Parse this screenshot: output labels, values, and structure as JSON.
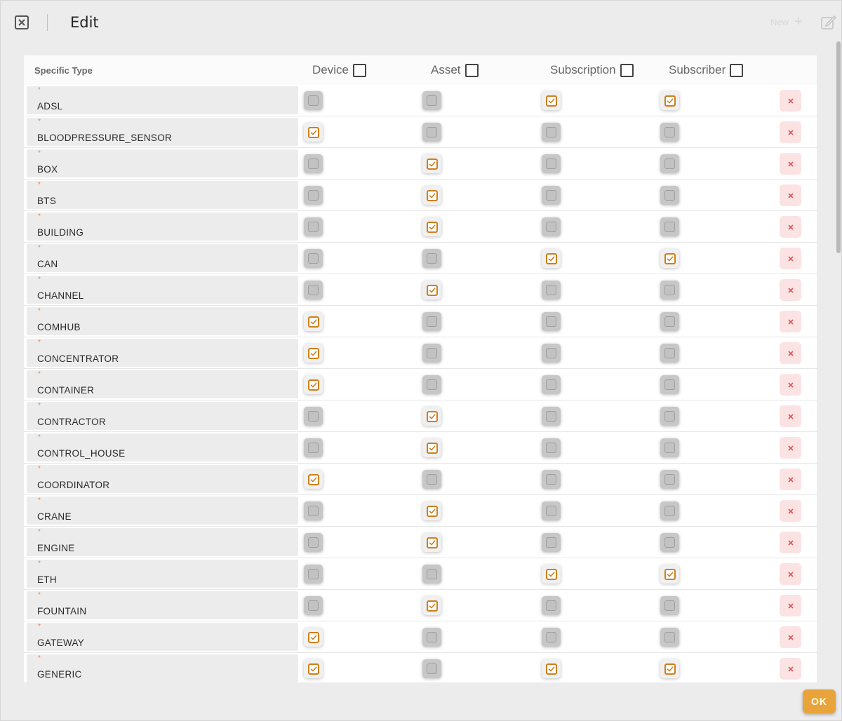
{
  "header": {
    "title": "Edit",
    "new_label": "New",
    "new_icon": "plus-icon",
    "close_icon": "close-x-icon",
    "edit_icon": "pencil-square-icon"
  },
  "table": {
    "first_column_label": "Specific Type",
    "columns": [
      "Device",
      "Asset",
      "Subscription",
      "Subscriber"
    ],
    "required_marker": "*",
    "rows": [
      {
        "type": "ADSL",
        "checks": [
          false,
          false,
          true,
          true
        ]
      },
      {
        "type": "BLOODPRESSURE_SENSOR",
        "checks": [
          true,
          false,
          false,
          false
        ]
      },
      {
        "type": "BOX",
        "checks": [
          false,
          true,
          false,
          false
        ]
      },
      {
        "type": "BTS",
        "checks": [
          false,
          true,
          false,
          false
        ]
      },
      {
        "type": "BUILDING",
        "checks": [
          false,
          true,
          false,
          false
        ]
      },
      {
        "type": "CAN",
        "checks": [
          false,
          false,
          true,
          true
        ]
      },
      {
        "type": "CHANNEL",
        "checks": [
          false,
          true,
          false,
          false
        ]
      },
      {
        "type": "COMHUB",
        "checks": [
          true,
          false,
          false,
          false
        ]
      },
      {
        "type": "CONCENTRATOR",
        "checks": [
          true,
          false,
          false,
          false
        ]
      },
      {
        "type": "CONTAINER",
        "checks": [
          true,
          false,
          false,
          false
        ]
      },
      {
        "type": "CONTRACTOR",
        "checks": [
          false,
          true,
          false,
          false
        ]
      },
      {
        "type": "CONTROL_HOUSE",
        "checks": [
          false,
          true,
          false,
          false
        ]
      },
      {
        "type": "COORDINATOR",
        "checks": [
          true,
          false,
          false,
          false
        ]
      },
      {
        "type": "CRANE",
        "checks": [
          false,
          true,
          false,
          false
        ]
      },
      {
        "type": "ENGINE",
        "checks": [
          false,
          true,
          false,
          false
        ]
      },
      {
        "type": "ETH",
        "checks": [
          false,
          false,
          true,
          true
        ]
      },
      {
        "type": "FOUNTAIN",
        "checks": [
          false,
          true,
          false,
          false
        ]
      },
      {
        "type": "GATEWAY",
        "checks": [
          true,
          false,
          false,
          false
        ]
      },
      {
        "type": "GENERIC",
        "checks": [
          true,
          false,
          true,
          true
        ]
      }
    ],
    "delete_icon": "delete-x-icon"
  },
  "footer": {
    "ok_label": "OK"
  },
  "colors": {
    "accent": "#cf7f1c",
    "ok_button": "#e8a43a",
    "delete_bg": "#fbe3e3",
    "delete_icon": "#e05555"
  }
}
